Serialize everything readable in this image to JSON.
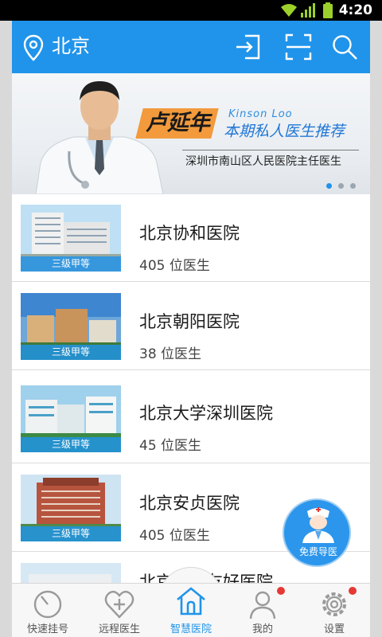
{
  "status_bar": {
    "time": "4:20"
  },
  "header": {
    "city": "北京"
  },
  "banner": {
    "doctor_name": "卢延年",
    "doctor_name_en": "Kinson Loo",
    "tagline": "本期私人医生推荐",
    "subtitle": "深圳市南山区人民医院主任医生"
  },
  "hospitals": [
    {
      "name": "北京协和医院",
      "doctors": "405 位医生",
      "grade": "三级甲等"
    },
    {
      "name": "北京朝阳医院",
      "doctors": "38 位医生",
      "grade": "三级甲等"
    },
    {
      "name": "北京大学深圳医院",
      "doctors": "45 位医生",
      "grade": "三级甲等"
    },
    {
      "name": "北京安贞医院",
      "doctors": "405 位医生",
      "grade": "三级甲等"
    },
    {
      "name": "北京中日友好医院",
      "doctors": "",
      "grade": ""
    }
  ],
  "fab": {
    "label": "免费导医"
  },
  "tabs": [
    {
      "label": "快速挂号",
      "icon": "dial-icon"
    },
    {
      "label": "远程医生",
      "icon": "heart-plus-icon"
    },
    {
      "label": "智慧医院",
      "icon": "hospital-icon"
    },
    {
      "label": "我的",
      "icon": "person-icon"
    },
    {
      "label": "设置",
      "icon": "gear-icon"
    }
  ],
  "colors": {
    "primary": "#2094ea",
    "accent": "#f29a3c",
    "badge": "#e53935"
  }
}
